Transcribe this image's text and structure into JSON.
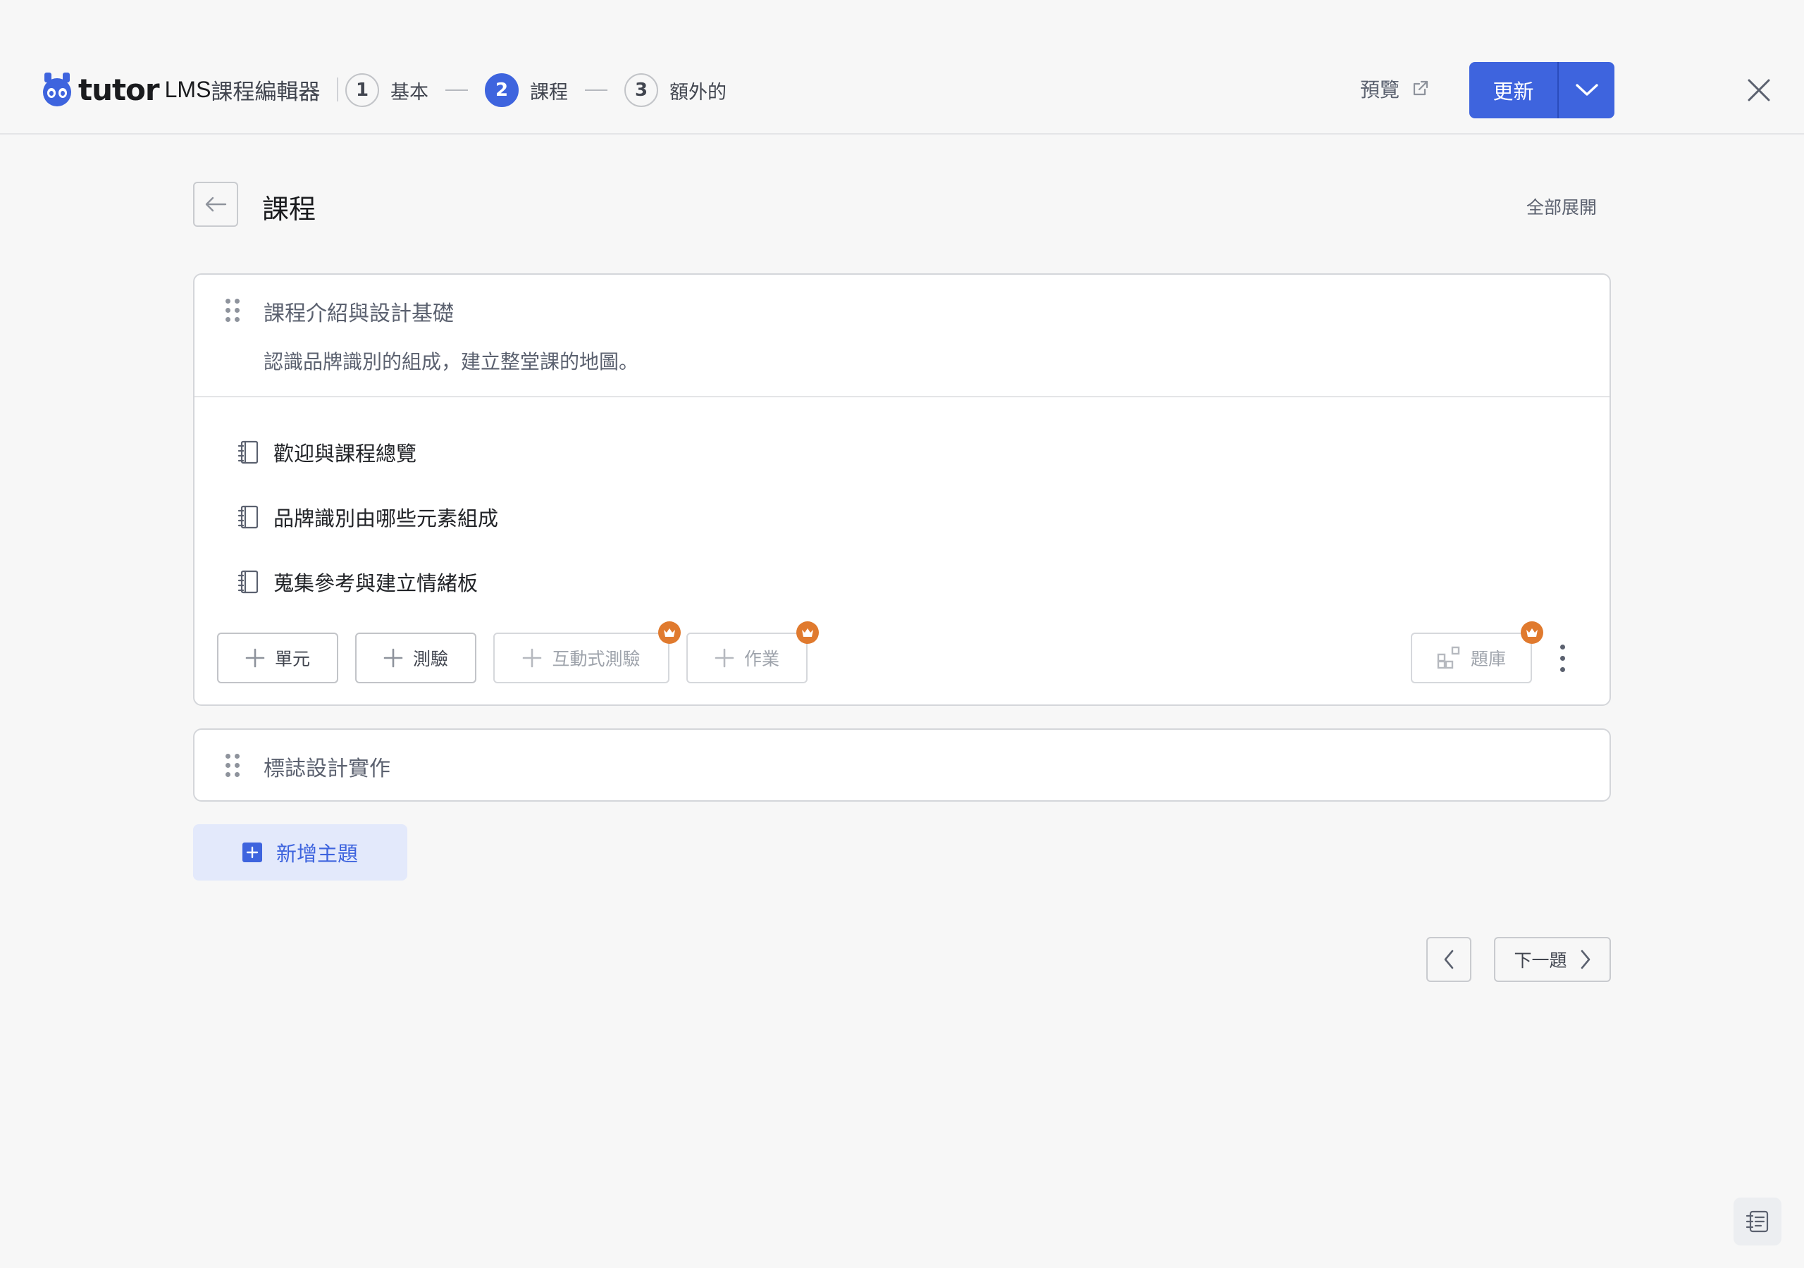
{
  "header": {
    "logo_word": "tutor",
    "logo_suffix": "LMS",
    "editor_title": "課程編輯器",
    "steps": [
      {
        "number": "1",
        "label": "基本",
        "active": false
      },
      {
        "number": "2",
        "label": "課程",
        "active": true
      },
      {
        "number": "3",
        "label": "額外的",
        "active": false
      }
    ],
    "preview_label": "預覽",
    "update_label": "更新"
  },
  "main": {
    "title": "課程",
    "expand_all_label": "全部展開",
    "topics": [
      {
        "title": "課程介紹與設計基礎",
        "summary": "認識品牌識別的組成，建立整堂課的地圖。",
        "lessons": [
          "歡迎與課程總覽",
          "品牌識別由哪些元素組成",
          "蒐集參考與建立情緒板"
        ],
        "actions": {
          "lesson": "單元",
          "quiz": "測驗",
          "interactive_quiz": "互動式測驗",
          "assignment": "作業",
          "question_bank": "題庫"
        }
      },
      {
        "title": "標誌設計實作"
      }
    ],
    "add_topic_label": "新增主題",
    "next_label": "下一題"
  },
  "colors": {
    "accent": "#3e64de",
    "pro_badge": "#e07a2e",
    "background": "#f7f7f7"
  }
}
